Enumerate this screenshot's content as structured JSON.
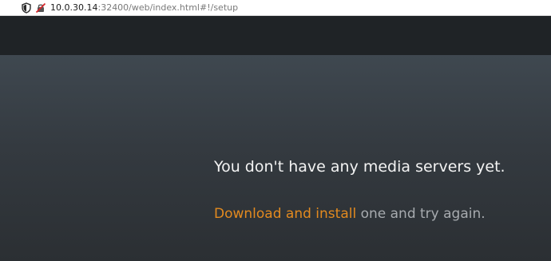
{
  "browser": {
    "url_host": "10.0.30.14",
    "url_path": ":32400/web/index.html#!/setup",
    "icons": [
      "shield-icon",
      "insecure-lock-icon"
    ]
  },
  "colors": {
    "topbar": "#1f2326",
    "background": "#3a4148",
    "link": "#e38a1f",
    "headline": "#f3f3f3",
    "muted": "#a7abaf"
  },
  "main": {
    "headline": "You don't have any media servers yet.",
    "link_label": "Download and install",
    "subline_rest": " one and try again."
  }
}
